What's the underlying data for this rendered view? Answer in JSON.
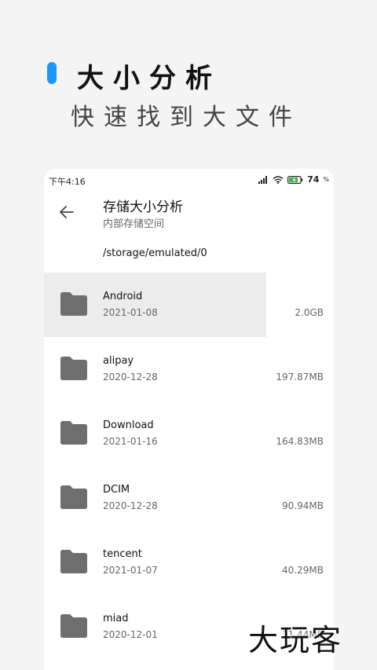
{
  "promo": {
    "title": "大小分析",
    "subtitle": "快速找到大文件",
    "accent_color": "#2196f3"
  },
  "status_bar": {
    "time": "下午4:16",
    "battery": "74",
    "battery_unit": "%"
  },
  "app_bar": {
    "title": "存储大小分析",
    "subtitle": "内部存储空间",
    "back_icon": "arrow-left-icon"
  },
  "path": "/storage/emulated/0",
  "folders": [
    {
      "name": "Android",
      "date": "2021-01-08",
      "size": "2.0GB"
    },
    {
      "name": "alipay",
      "date": "2020-12-28",
      "size": "197.87MB"
    },
    {
      "name": "Download",
      "date": "2021-01-16",
      "size": "164.83MB"
    },
    {
      "name": "DCIM",
      "date": "2020-12-28",
      "size": "90.94MB"
    },
    {
      "name": "tencent",
      "date": "2021-01-07",
      "size": "40.29MB"
    },
    {
      "name": "miad",
      "date": "2020-12-01",
      "size": "31.44MB"
    }
  ],
  "watermark": "大玩客"
}
